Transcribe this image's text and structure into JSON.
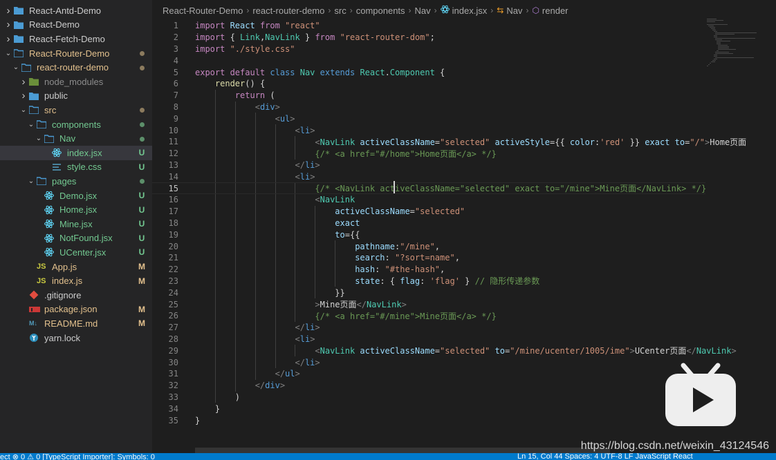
{
  "explorer": {
    "items": [
      {
        "label": "React-Antd-Demo",
        "kind": "folder",
        "depth": 0,
        "expanded": false,
        "color": "default",
        "status": ""
      },
      {
        "label": "React-Demo",
        "kind": "folder",
        "depth": 0,
        "expanded": false,
        "color": "default",
        "status": ""
      },
      {
        "label": "React-Fetch-Demo",
        "kind": "folder",
        "depth": 0,
        "expanded": false,
        "color": "default",
        "status": ""
      },
      {
        "label": "React-Router-Demo",
        "kind": "folder-open",
        "depth": 0,
        "expanded": true,
        "color": "modified",
        "status": "dot"
      },
      {
        "label": "react-router-demo",
        "kind": "folder-open",
        "depth": 1,
        "expanded": true,
        "color": "modified",
        "status": "dot"
      },
      {
        "label": "node_modules",
        "kind": "folder-lib",
        "depth": 2,
        "expanded": false,
        "color": "ignored",
        "status": ""
      },
      {
        "label": "public",
        "kind": "folder",
        "depth": 2,
        "expanded": false,
        "color": "default",
        "status": ""
      },
      {
        "label": "src",
        "kind": "folder-open",
        "depth": 2,
        "expanded": true,
        "color": "modified",
        "status": "dot"
      },
      {
        "label": "components",
        "kind": "folder-open",
        "depth": 3,
        "expanded": true,
        "color": "untracked",
        "status": "dot"
      },
      {
        "label": "Nav",
        "kind": "folder-open",
        "depth": 4,
        "expanded": true,
        "color": "untracked",
        "status": "dot"
      },
      {
        "label": "index.jsx",
        "kind": "react",
        "depth": 5,
        "expanded": null,
        "color": "untracked",
        "status": "U",
        "selected": true
      },
      {
        "label": "style.css",
        "kind": "css",
        "depth": 5,
        "expanded": null,
        "color": "untracked",
        "status": "U"
      },
      {
        "label": "pages",
        "kind": "folder-open",
        "depth": 3,
        "expanded": true,
        "color": "untracked",
        "status": "dot"
      },
      {
        "label": "Demo.jsx",
        "kind": "react",
        "depth": 4,
        "expanded": null,
        "color": "untracked",
        "status": "U"
      },
      {
        "label": "Home.jsx",
        "kind": "react",
        "depth": 4,
        "expanded": null,
        "color": "untracked",
        "status": "U"
      },
      {
        "label": "Mine.jsx",
        "kind": "react",
        "depth": 4,
        "expanded": null,
        "color": "untracked",
        "status": "U"
      },
      {
        "label": "NotFound.jsx",
        "kind": "react",
        "depth": 4,
        "expanded": null,
        "color": "untracked",
        "status": "U"
      },
      {
        "label": "UCenter.jsx",
        "kind": "react",
        "depth": 4,
        "expanded": null,
        "color": "untracked",
        "status": "U"
      },
      {
        "label": "App.js",
        "kind": "js",
        "depth": 3,
        "expanded": null,
        "color": "modified",
        "status": "M"
      },
      {
        "label": "index.js",
        "kind": "js",
        "depth": 3,
        "expanded": null,
        "color": "modified",
        "status": "M"
      },
      {
        "label": ".gitignore",
        "kind": "git",
        "depth": 2,
        "expanded": null,
        "color": "default",
        "status": ""
      },
      {
        "label": "package.json",
        "kind": "npm",
        "depth": 2,
        "expanded": null,
        "color": "modified",
        "status": "M"
      },
      {
        "label": "README.md",
        "kind": "md",
        "depth": 2,
        "expanded": null,
        "color": "modified",
        "status": "M"
      },
      {
        "label": "yarn.lock",
        "kind": "yarn",
        "depth": 2,
        "expanded": null,
        "color": "default",
        "status": ""
      }
    ]
  },
  "breadcrumb": {
    "parts": [
      "React-Router-Demo",
      "react-router-demo",
      "src",
      "components",
      "Nav",
      "index.jsx",
      "Nav",
      "render"
    ]
  },
  "editor": {
    "active_line": 15,
    "lines": [
      [
        [
          "kw",
          "import "
        ],
        [
          "var",
          "React "
        ],
        [
          "kw",
          "from "
        ],
        [
          "str",
          "\"react\""
        ]
      ],
      [
        [
          "kw",
          "import "
        ],
        [
          "txt",
          "{ "
        ],
        [
          "comp",
          "Link"
        ],
        [
          "txt",
          ","
        ],
        [
          "comp",
          "NavLink"
        ],
        [
          "txt",
          " } "
        ],
        [
          "kw",
          "from "
        ],
        [
          "str",
          "\"react-router-dom\""
        ],
        [
          "txt",
          ";"
        ]
      ],
      [
        [
          "kw",
          "import "
        ],
        [
          "str",
          "\"./style.css\""
        ]
      ],
      [],
      [
        [
          "kw",
          "export "
        ],
        [
          "kw",
          "default "
        ],
        [
          "kwb",
          "class "
        ],
        [
          "comp",
          "Nav "
        ],
        [
          "kwb",
          "extends "
        ],
        [
          "comp",
          "React"
        ],
        [
          "txt",
          "."
        ],
        [
          "comp",
          "Component "
        ],
        [
          "txt",
          "{"
        ]
      ],
      [
        [
          "txt",
          "    "
        ],
        [
          "fn",
          "render"
        ],
        [
          "txt",
          "() {"
        ]
      ],
      [
        [
          "txt",
          "        "
        ],
        [
          "kw",
          "return "
        ],
        [
          "txt",
          "("
        ]
      ],
      [
        [
          "txt",
          "            "
        ],
        [
          "tagp",
          "<"
        ],
        [
          "tag",
          "div"
        ],
        [
          "tagp",
          ">"
        ]
      ],
      [
        [
          "txt",
          "                "
        ],
        [
          "tagp",
          "<"
        ],
        [
          "tag",
          "ul"
        ],
        [
          "tagp",
          ">"
        ]
      ],
      [
        [
          "txt",
          "                    "
        ],
        [
          "tagp",
          "<"
        ],
        [
          "tag",
          "li"
        ],
        [
          "tagp",
          ">"
        ]
      ],
      [
        [
          "txt",
          "                        "
        ],
        [
          "tagp",
          "<"
        ],
        [
          "comp",
          "NavLink "
        ],
        [
          "attr",
          "activeClassName"
        ],
        [
          "txt",
          "="
        ],
        [
          "str",
          "\"selected\" "
        ],
        [
          "attr",
          "activeStyle"
        ],
        [
          "txt",
          "={{ "
        ],
        [
          "attr",
          "color"
        ],
        [
          "txt",
          ":"
        ],
        [
          "str",
          "'red'"
        ],
        [
          "txt",
          " }} "
        ],
        [
          "attr",
          "exact "
        ],
        [
          "attr",
          "to"
        ],
        [
          "txt",
          "="
        ],
        [
          "str",
          "\"/\""
        ],
        [
          "tagp",
          ">"
        ],
        [
          "txt",
          "Home页面"
        ]
      ],
      [
        [
          "txt",
          "                        "
        ],
        [
          "cmt",
          "{/* <a href=\"#/home\">Home页面</a> */}"
        ]
      ],
      [
        [
          "txt",
          "                    "
        ],
        [
          "tagp",
          "</"
        ],
        [
          "tag",
          "li"
        ],
        [
          "tagp",
          ">"
        ]
      ],
      [
        [
          "txt",
          "                    "
        ],
        [
          "tagp",
          "<"
        ],
        [
          "tag",
          "li"
        ],
        [
          "tagp",
          ">"
        ]
      ],
      [
        [
          "txt",
          "                        "
        ],
        [
          "cmt",
          "{/* <NavLink activeClassName=\"selected\" exact to=\"/mine\">Mine页面</NavLink> */}"
        ]
      ],
      [
        [
          "txt",
          "                        "
        ],
        [
          "tagp",
          "<"
        ],
        [
          "comp",
          "NavLink"
        ]
      ],
      [
        [
          "txt",
          "                            "
        ],
        [
          "attr",
          "activeClassName"
        ],
        [
          "txt",
          "="
        ],
        [
          "str",
          "\"selected\""
        ]
      ],
      [
        [
          "txt",
          "                            "
        ],
        [
          "attr",
          "exact"
        ]
      ],
      [
        [
          "txt",
          "                            "
        ],
        [
          "attr",
          "to"
        ],
        [
          "txt",
          "={{"
        ]
      ],
      [
        [
          "txt",
          "                                "
        ],
        [
          "attr",
          "pathname"
        ],
        [
          "txt",
          ":"
        ],
        [
          "str",
          "\"/mine\""
        ],
        [
          "txt",
          ","
        ]
      ],
      [
        [
          "txt",
          "                                "
        ],
        [
          "attr",
          "search"
        ],
        [
          "txt",
          ": "
        ],
        [
          "str",
          "\"?sort=name\""
        ],
        [
          "txt",
          ","
        ]
      ],
      [
        [
          "txt",
          "                                "
        ],
        [
          "attr",
          "hash"
        ],
        [
          "txt",
          ": "
        ],
        [
          "str",
          "\"#the-hash\""
        ],
        [
          "txt",
          ","
        ]
      ],
      [
        [
          "txt",
          "                                "
        ],
        [
          "attr",
          "state"
        ],
        [
          "txt",
          ": { "
        ],
        [
          "attr",
          "flag"
        ],
        [
          "txt",
          ": "
        ],
        [
          "str",
          "'flag'"
        ],
        [
          "txt",
          " } "
        ],
        [
          "cmt",
          "// 隐形传递参数"
        ]
      ],
      [
        [
          "txt",
          "                            "
        ],
        [
          "txt",
          "}}"
        ]
      ],
      [
        [
          "txt",
          "                        "
        ],
        [
          "tagp",
          ">"
        ],
        [
          "txt",
          "Mine页面"
        ],
        [
          "tagp",
          "</"
        ],
        [
          "comp",
          "NavLink"
        ],
        [
          "tagp",
          ">"
        ]
      ],
      [
        [
          "txt",
          "                        "
        ],
        [
          "cmt",
          "{/* <a href=\"#/mine\">Mine页面</a> */}"
        ]
      ],
      [
        [
          "txt",
          "                    "
        ],
        [
          "tagp",
          "</"
        ],
        [
          "tag",
          "li"
        ],
        [
          "tagp",
          ">"
        ]
      ],
      [
        [
          "txt",
          "                    "
        ],
        [
          "tagp",
          "<"
        ],
        [
          "tag",
          "li"
        ],
        [
          "tagp",
          ">"
        ]
      ],
      [
        [
          "txt",
          "                        "
        ],
        [
          "tagp",
          "<"
        ],
        [
          "comp",
          "NavLink "
        ],
        [
          "attr",
          "activeClassName"
        ],
        [
          "txt",
          "="
        ],
        [
          "str",
          "\"selected\" "
        ],
        [
          "attr",
          "to"
        ],
        [
          "txt",
          "="
        ],
        [
          "str",
          "\"/mine/ucenter/1005/ime\""
        ],
        [
          "tagp",
          ">"
        ],
        [
          "txt",
          "UCenter页面"
        ],
        [
          "tagp",
          "</"
        ],
        [
          "comp",
          "NavLink"
        ],
        [
          "tagp",
          ">"
        ]
      ],
      [
        [
          "txt",
          "                    "
        ],
        [
          "tagp",
          "</"
        ],
        [
          "tag",
          "li"
        ],
        [
          "tagp",
          ">"
        ]
      ],
      [
        [
          "txt",
          "                "
        ],
        [
          "tagp",
          "</"
        ],
        [
          "tag",
          "ul"
        ],
        [
          "tagp",
          ">"
        ]
      ],
      [
        [
          "txt",
          "            "
        ],
        [
          "tagp",
          "</"
        ],
        [
          "tag",
          "div"
        ],
        [
          "tagp",
          ">"
        ]
      ],
      [
        [
          "txt",
          "        )"
        ]
      ],
      [
        [
          "txt",
          "    }"
        ]
      ],
      [
        [
          "txt",
          "}"
        ]
      ]
    ]
  },
  "watermark": {
    "url": "https://blog.csdn.net/weixin_43124546"
  },
  "statusbar": {
    "left": "ect    ⊗ 0 ⚠ 0    [TypeScript Importer]: Symbols: 0",
    "right": "Ln 15, Col 44    Spaces: 4    UTF-8    LF    JavaScript React"
  },
  "colors": {
    "sidebar_bg": "#252526",
    "editor_bg": "#1e1e1e",
    "statusbar_bg": "#007acc",
    "modified": "#e2c08d",
    "untracked": "#73c991"
  }
}
